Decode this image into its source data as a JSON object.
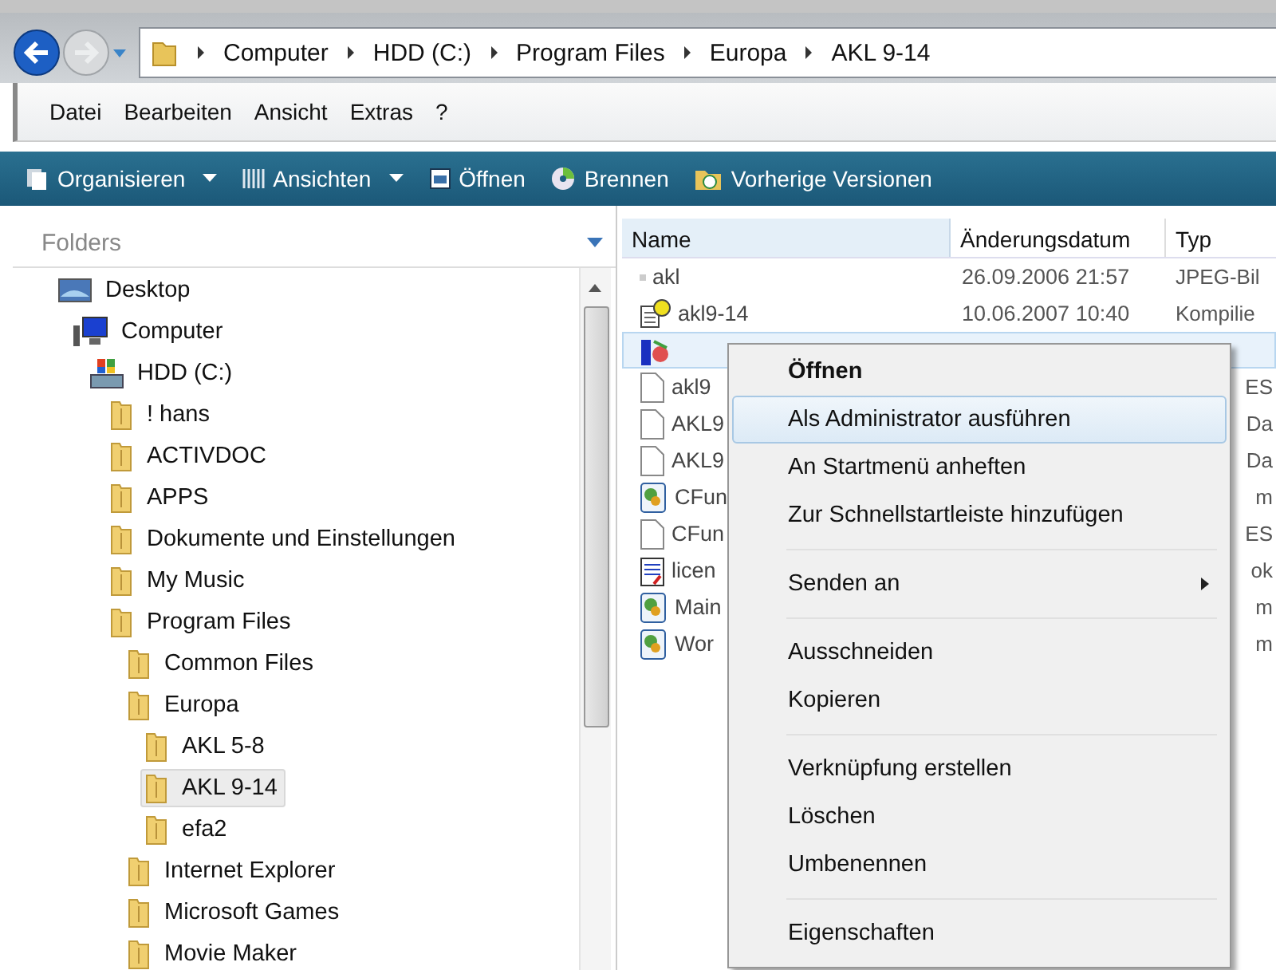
{
  "address": {
    "crumbs": [
      "Computer",
      "HDD (C:)",
      "Program Files",
      "Europa",
      "AKL 9-14"
    ]
  },
  "menu_bar": [
    "Datei",
    "Bearbeiten",
    "Ansicht",
    "Extras",
    "?"
  ],
  "toolbar": [
    {
      "label": "Organisieren",
      "kind": "organize",
      "dropdown": true
    },
    {
      "label": "Ansichten",
      "kind": "views",
      "dropdown": true
    },
    {
      "label": "Öffnen",
      "kind": "open",
      "dropdown": false
    },
    {
      "label": "Brennen",
      "kind": "burn",
      "dropdown": false
    },
    {
      "label": "Vorherige Versionen",
      "kind": "versions",
      "dropdown": false
    }
  ],
  "folders_pane": {
    "title": "Folders",
    "tree": [
      {
        "label": "Desktop",
        "kind": "desktop",
        "selected": false,
        "children": [
          {
            "label": "Computer",
            "kind": "computer",
            "selected": false,
            "children": [
              {
                "label": "HDD (C:)",
                "kind": "drive",
                "selected": false,
                "children": [
                  {
                    "label": "! hans",
                    "kind": "folder",
                    "selected": false
                  },
                  {
                    "label": "ACTIVDOC",
                    "kind": "folder",
                    "selected": false
                  },
                  {
                    "label": "APPS",
                    "kind": "folder",
                    "selected": false
                  },
                  {
                    "label": "Dokumente und Einstellungen",
                    "kind": "folder",
                    "selected": false
                  },
                  {
                    "label": "My Music",
                    "kind": "folder",
                    "selected": false
                  },
                  {
                    "label": "Program Files",
                    "kind": "folder",
                    "selected": false,
                    "children": [
                      {
                        "label": "Common Files",
                        "kind": "folder",
                        "selected": false
                      },
                      {
                        "label": "Europa",
                        "kind": "folder",
                        "selected": false,
                        "children": [
                          {
                            "label": "AKL 5-8",
                            "kind": "folder",
                            "selected": false
                          },
                          {
                            "label": "AKL 9-14",
                            "kind": "folder",
                            "selected": true
                          },
                          {
                            "label": "efa2",
                            "kind": "folder",
                            "selected": false
                          }
                        ]
                      },
                      {
                        "label": "Internet Explorer",
                        "kind": "folder",
                        "selected": false
                      },
                      {
                        "label": "Microsoft Games",
                        "kind": "folder",
                        "selected": false
                      },
                      {
                        "label": "Movie Maker",
                        "kind": "folder",
                        "selected": false
                      }
                    ]
                  }
                ]
              }
            ]
          }
        ]
      }
    ]
  },
  "file_list": {
    "columns": [
      "Name",
      "Änderungsdatum",
      "Typ"
    ],
    "rows": [
      {
        "name": "akl",
        "date": "26.09.2006 21:57",
        "type": "JPEG-Bil",
        "kind": "image",
        "selected": false
      },
      {
        "name": "akl9-14",
        "date": "10.06.2007 10:40",
        "type": "Kompilie",
        "kind": "help",
        "selected": false
      },
      {
        "kind": "app",
        "selected": true
      },
      {
        "name": "akl9",
        "type": "ES",
        "kind": "file",
        "selected": false
      },
      {
        "name": "AKL9",
        "type": "Da",
        "kind": "file",
        "selected": false
      },
      {
        "name": "AKL9",
        "type": "Da",
        "kind": "file",
        "selected": false
      },
      {
        "name": "CFun",
        "type": "m",
        "kind": "gear",
        "selected": false
      },
      {
        "name": "CFun",
        "type": "ES",
        "kind": "file",
        "selected": false
      },
      {
        "name": "licen",
        "type": "ok",
        "kind": "text",
        "selected": false
      },
      {
        "name": "Main",
        "type": "m",
        "kind": "gear",
        "selected": false
      },
      {
        "name": "Wor",
        "type": "m",
        "kind": "gear",
        "selected": false
      }
    ]
  },
  "context_menu": {
    "groups": [
      [
        {
          "label": "Öffnen",
          "bold": true,
          "selected": false,
          "submenu": false
        },
        {
          "label": "Als Administrator ausführen",
          "bold": false,
          "selected": true,
          "submenu": false
        },
        {
          "label": "An Startmenü anheften",
          "bold": false,
          "selected": false,
          "submenu": false
        },
        {
          "label": "Zur Schnellstartleiste hinzufügen",
          "bold": false,
          "selected": false,
          "submenu": false
        }
      ],
      [
        {
          "label": "Senden an",
          "bold": false,
          "selected": false,
          "submenu": true
        }
      ],
      [
        {
          "label": "Ausschneiden",
          "bold": false,
          "selected": false,
          "submenu": false
        },
        {
          "label": "Kopieren",
          "bold": false,
          "selected": false,
          "submenu": false
        }
      ],
      [
        {
          "label": "Verknüpfung erstellen",
          "bold": false,
          "selected": false,
          "submenu": false
        },
        {
          "label": "Löschen",
          "bold": false,
          "selected": false,
          "submenu": false
        },
        {
          "label": "Umbenennen",
          "bold": false,
          "selected": false,
          "submenu": false
        }
      ],
      [
        {
          "label": "Eigenschaften",
          "bold": false,
          "selected": false,
          "submenu": false
        }
      ]
    ]
  }
}
